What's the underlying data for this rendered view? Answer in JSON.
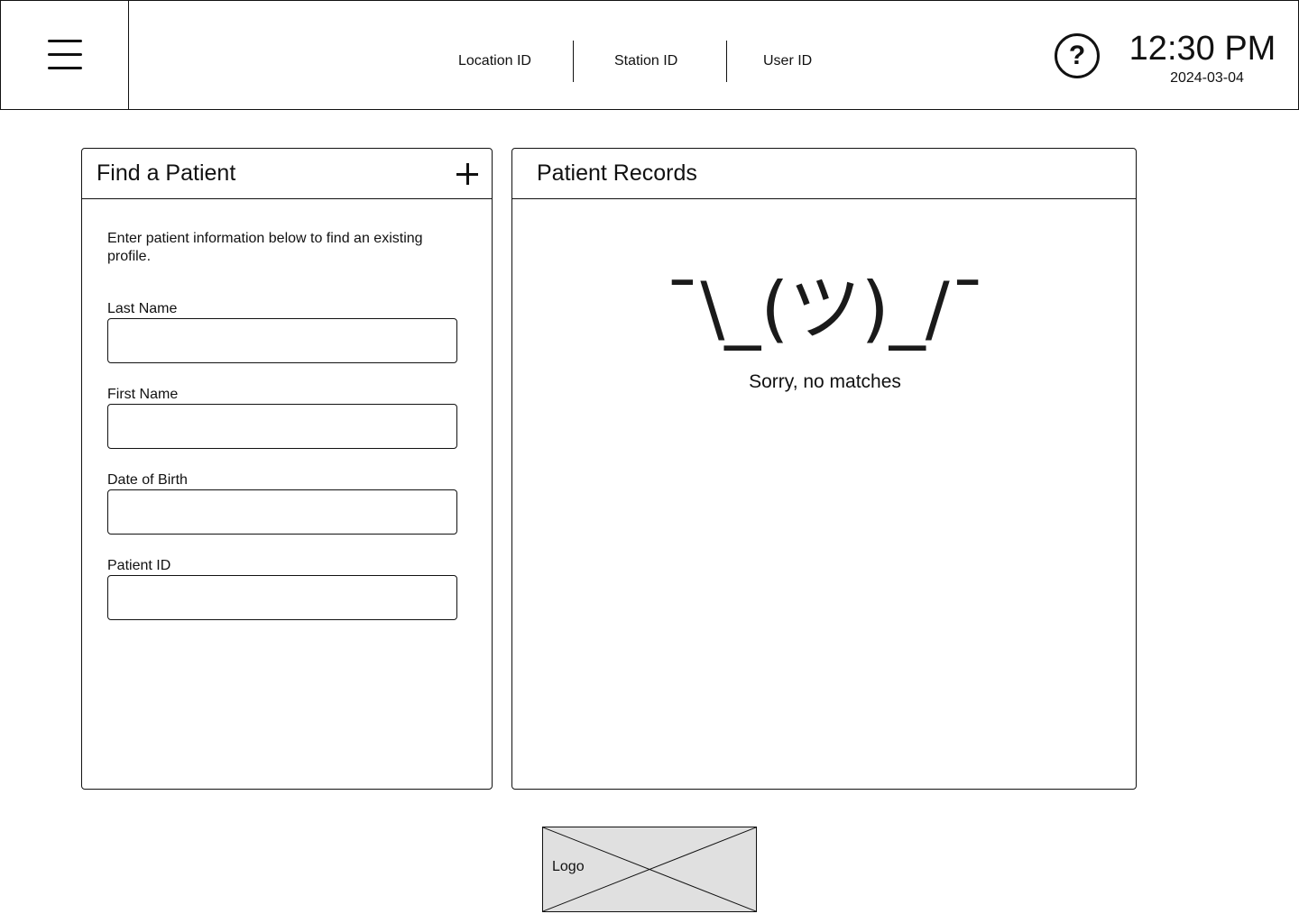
{
  "header": {
    "location_label": "Location ID",
    "station_label": "Station ID",
    "user_label": "User ID",
    "help_symbol": "?",
    "time": "12:30 PM",
    "date": "2024-03-04",
    "menu_icon": "hamburger-menu-icon",
    "help_icon": "question-circle-icon"
  },
  "find_panel": {
    "title": "Find a Patient",
    "add_icon": "plus-icon",
    "intro": "Enter patient information below to find an existing profile.",
    "fields": [
      {
        "label": "Last Name",
        "value": ""
      },
      {
        "label": "First Name",
        "value": ""
      },
      {
        "label": "Date of Birth",
        "value": ""
      },
      {
        "label": "Patient ID",
        "value": ""
      }
    ]
  },
  "records_panel": {
    "title": "Patient Records",
    "emoticon": "¯\\_(ツ)_/¯",
    "empty_message": "Sorry, no matches"
  },
  "footer": {
    "logo_label": "Logo"
  },
  "colors": {
    "border": "#111111",
    "logo_fill": "#e0e0e0",
    "background": "#ffffff"
  }
}
